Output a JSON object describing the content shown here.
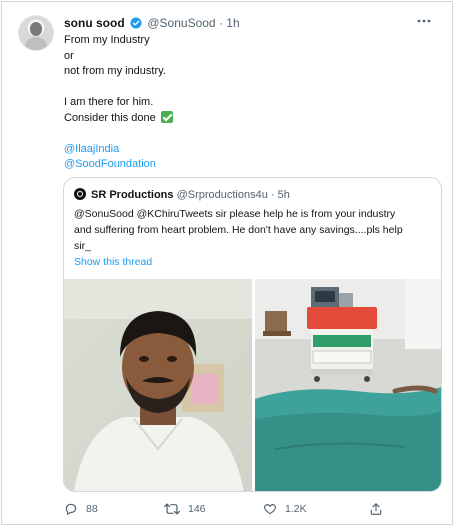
{
  "tweet": {
    "author_name": "sonu sood",
    "author_handle": "@SonuSood",
    "separator": "·",
    "time": "1h",
    "text_lines": [
      "From my Industry",
      "or",
      "not from my industry."
    ],
    "text_lines_2": [
      "I am there for him."
    ],
    "consider_line": "Consider this done",
    "mentions": [
      "@IlaajIndia",
      "@SoodFoundation"
    ]
  },
  "quote": {
    "author_name": "SR Productions",
    "author_handle": "@Srproductions4u",
    "separator": "·",
    "time": "5h",
    "text_lines": [
      "@SonuSood @KChiruTweets  sir  please help he is from your industry",
      "and suffering from heart problem. He don't have any savings....pls help",
      "sir_"
    ],
    "show_thread": "Show this thread"
  },
  "actions": {
    "reply_count": "88",
    "retweet_count": "146",
    "like_count": "1.2K"
  },
  "colors": {
    "link": "#1d9bf0",
    "verified": "#1d9bf0",
    "muted": "#536471",
    "check": "#4caf50"
  },
  "icons": {
    "verified": "verified-badge-icon",
    "more": "more-options-icon",
    "reply": "reply-icon",
    "retweet": "retweet-icon",
    "like": "heart-icon",
    "share": "share-icon",
    "check": "check-mark-emoji"
  }
}
